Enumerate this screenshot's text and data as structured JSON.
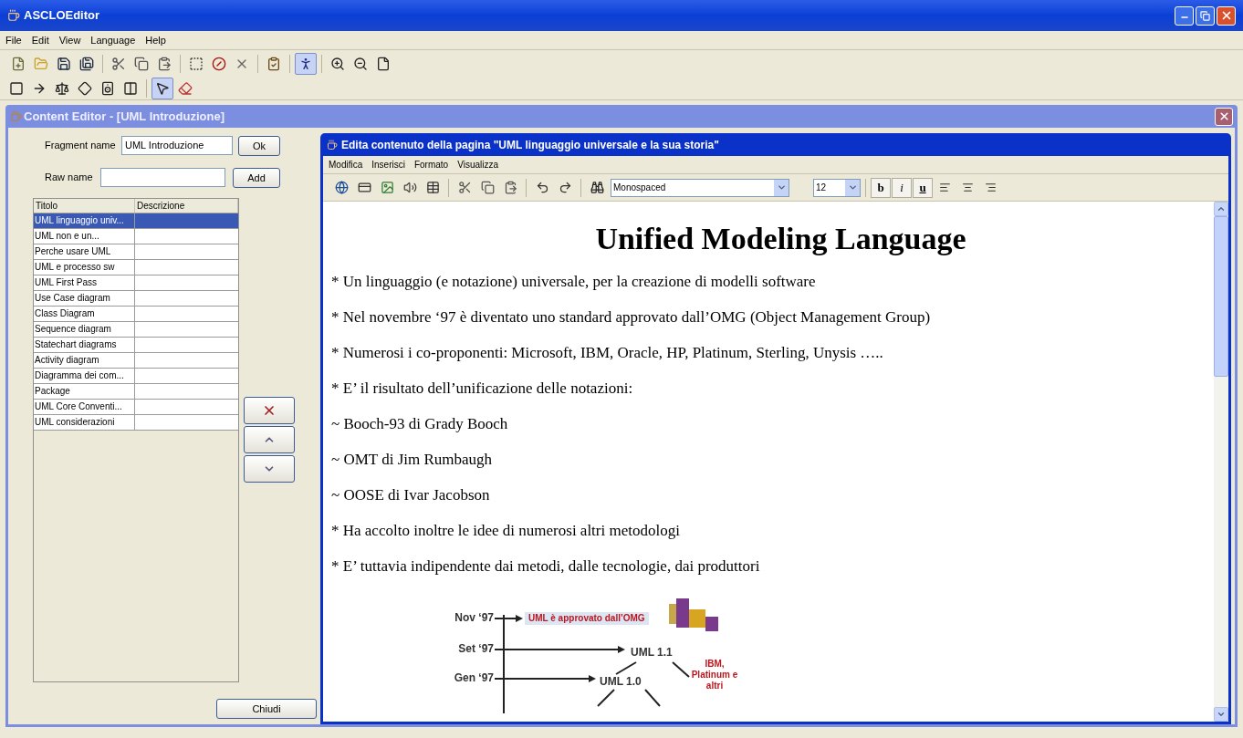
{
  "app_window": {
    "title": "ASCLOEditor"
  },
  "menu_bar": [
    "File",
    "Edit",
    "View",
    "Language",
    "Help"
  ],
  "toolbar_main": [
    {
      "kind": "new",
      "selected": false
    },
    {
      "kind": "open",
      "selected": false
    },
    {
      "kind": "save",
      "selected": false
    },
    {
      "kind": "save-as",
      "selected": false
    },
    {
      "kind": "separator"
    },
    {
      "kind": "cut",
      "selected": false
    },
    {
      "kind": "copy",
      "selected": false
    },
    {
      "kind": "paste",
      "selected": false
    },
    {
      "kind": "separator"
    },
    {
      "kind": "frame",
      "selected": false
    },
    {
      "kind": "no-frame",
      "selected": false
    },
    {
      "kind": "delete",
      "selected": false
    },
    {
      "kind": "separator"
    },
    {
      "kind": "check",
      "selected": false
    },
    {
      "kind": "separator"
    },
    {
      "kind": "person",
      "selected": true
    },
    {
      "kind": "separator"
    },
    {
      "kind": "zoom-in",
      "selected": false
    },
    {
      "kind": "zoom-out",
      "selected": false
    },
    {
      "kind": "page",
      "selected": false
    }
  ],
  "toolbar_shapes": [
    {
      "kind": "rectangle",
      "selected": false
    },
    {
      "kind": "arrow",
      "selected": false
    },
    {
      "kind": "scale",
      "selected": false
    },
    {
      "kind": "diamond",
      "selected": false
    },
    {
      "kind": "speaker",
      "selected": false
    },
    {
      "kind": "panel",
      "selected": false
    },
    {
      "kind": "separator"
    },
    {
      "kind": "pointer",
      "selected": true
    },
    {
      "kind": "eraser",
      "selected": false
    }
  ],
  "content_editor": {
    "title": "Content Editor - [UML Introduzione]",
    "fragment_name": {
      "label": "Fragment name",
      "value": "UML Introduzione",
      "button": "Ok"
    },
    "raw_name": {
      "label": "Raw name",
      "button": "Add"
    },
    "table": {
      "columns": [
        "Titolo",
        "Descrizione"
      ],
      "rows": [
        {
          "title": "UML linguaggio univ...",
          "selected": true
        },
        {
          "title": "UML non e un...",
          "selected": false
        },
        {
          "title": "Perche usare UML",
          "selected": false
        },
        {
          "title": "UML e processo sw",
          "selected": false
        },
        {
          "title": "UML First Pass",
          "selected": false
        },
        {
          "title": "Use Case diagram",
          "selected": false
        },
        {
          "title": "Class Diagram",
          "selected": false
        },
        {
          "title": "Sequence diagram",
          "selected": false
        },
        {
          "title": "Statechart diagrams",
          "selected": false
        },
        {
          "title": "Activity diagram",
          "selected": false
        },
        {
          "title": "Diagramma dei com...",
          "selected": false
        },
        {
          "title": "Package",
          "selected": false
        },
        {
          "title": "UML Core Conventi...",
          "selected": false
        },
        {
          "title": "UML considerazioni",
          "selected": false
        }
      ]
    },
    "close_button": "Chiudi"
  },
  "page_editor": {
    "title": "Edita contenuto della pagina \"UML linguaggio universale e la sua storia\"",
    "menu_bar": [
      "Modifica",
      "Inserisci",
      "Formato",
      "Visualizza"
    ],
    "toolbar": [
      {
        "kind": "globe"
      },
      {
        "kind": "card"
      },
      {
        "kind": "image"
      },
      {
        "kind": "sound"
      },
      {
        "kind": "table"
      },
      {
        "kind": "separator"
      },
      {
        "kind": "cut"
      },
      {
        "kind": "copy"
      },
      {
        "kind": "paste"
      },
      {
        "kind": "separator"
      },
      {
        "kind": "undo"
      },
      {
        "kind": "redo"
      },
      {
        "kind": "separator"
      },
      {
        "kind": "find"
      }
    ],
    "font": "Monospaced",
    "size": "12",
    "format_buttons": [
      {
        "kind": "bold",
        "label": "b"
      },
      {
        "kind": "italic",
        "label": "i"
      },
      {
        "kind": "underline",
        "label": "u"
      }
    ],
    "align_buttons": [
      {
        "kind": "left"
      },
      {
        "kind": "center"
      },
      {
        "kind": "right"
      }
    ],
    "document": {
      "heading": "Unified Modeling Language",
      "paragraphs": [
        "* Un linguaggio (e notazione) universale, per la creazione di modelli software",
        "* Nel novembre ‘97 è diventato uno standard approvato dall’OMG (Object Management Group)",
        "* Numerosi i co-proponenti: Microsoft, IBM, Oracle, HP, Platinum, Sterling, Unysis …..",
        "* E’ il risultato dell’unificazione delle notazioni:",
        "~ Booch-93 di Grady Booch",
        "~ OMT di Jim Rumbaugh",
        "~ OOSE di Ivar Jacobson",
        "* Ha accolto inoltre le idee di numerosi altri metodologi",
        "* E’ tuttavia indipendente dai metodi, dalle tecnologie, dai produttori"
      ],
      "timeline": {
        "events": [
          {
            "kind": "banner",
            "date": "Nov ‘97",
            "label": "UML è approvato dall’OMG"
          },
          {
            "kind": "version",
            "date": "Set ‘97",
            "label": "UML 1.1"
          },
          {
            "kind": "version",
            "date": "Gen ‘97",
            "label": "UML 1.0"
          }
        ],
        "note": "IBM, Platinum e altri"
      }
    }
  }
}
